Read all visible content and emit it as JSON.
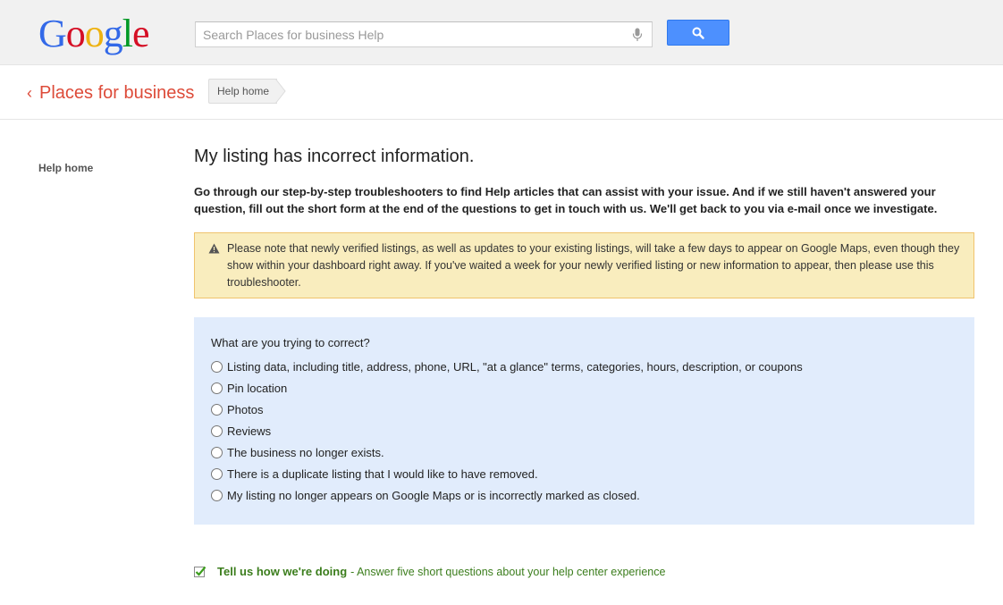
{
  "header": {
    "logo_letters": [
      {
        "ch": "G",
        "color": "#3369e8"
      },
      {
        "ch": "o",
        "color": "#d50f25"
      },
      {
        "ch": "o",
        "color": "#eeb211"
      },
      {
        "ch": "g",
        "color": "#3369e8"
      },
      {
        "ch": "l",
        "color": "#009925"
      },
      {
        "ch": "e",
        "color": "#d50f25"
      }
    ],
    "search_placeholder": "Search Places for business Help",
    "search_value": ""
  },
  "subheader": {
    "back_chevron": "‹",
    "product_link": "Places for business",
    "breadcrumb": "Help home"
  },
  "sidebar": {
    "links": [
      "Help home"
    ]
  },
  "main": {
    "title": "My listing has incorrect information.",
    "intro": "Go through our step-by-step troubleshooters to find Help articles that can assist with your issue. And if we still haven't answered your question, fill out the short form at the end of the questions to get in touch with us. We'll get back to you via e-mail once we investigate.",
    "notice": "Please note that newly verified listings, as well as updates to your existing listings, will take a few days to appear on Google Maps, even though they show within your dashboard right away. If you've waited a week for your newly verified listing or new information to appear, then please use this troubleshooter.",
    "question": "What are you trying to correct?",
    "options": [
      "Listing data, including title, address, phone, URL, \"at a glance\" terms, categories, hours, description, or coupons",
      "Pin location",
      "Photos",
      "Reviews",
      "The business no longer exists.",
      "There is a duplicate listing that I would like to have removed.",
      "My listing no longer appears on Google Maps or is incorrectly marked as closed."
    ]
  },
  "feedback": {
    "link": "Tell us how we're doing",
    "sub": "- Answer five short questions about your help center experience"
  },
  "colors": {
    "accent_red": "#dd4b39",
    "search_blue": "#4d90fe",
    "notice_bg": "#f9edbe",
    "question_bg": "#e1ecfc",
    "feedback_green": "#3b7d1c"
  }
}
